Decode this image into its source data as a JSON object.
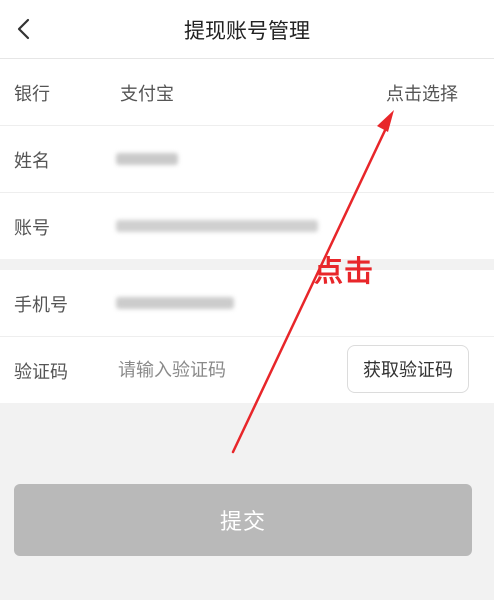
{
  "header": {
    "title": "提现账号管理",
    "back_icon": "chevron-left-icon"
  },
  "form": {
    "bank_label": "银行",
    "bank_value": "支付宝",
    "bank_select": "点击选择",
    "name_label": "姓名",
    "account_label": "账号",
    "phone_label": "手机号",
    "code_label": "验证码",
    "code_placeholder": "请输入验证码",
    "get_code_button": "获取验证码"
  },
  "submit_label": "提交",
  "annotation": {
    "text": "点击",
    "color": "#e8262a"
  },
  "colors": {
    "submit_bg": "#b9b9b9",
    "page_bg": "#f2f2f2"
  }
}
